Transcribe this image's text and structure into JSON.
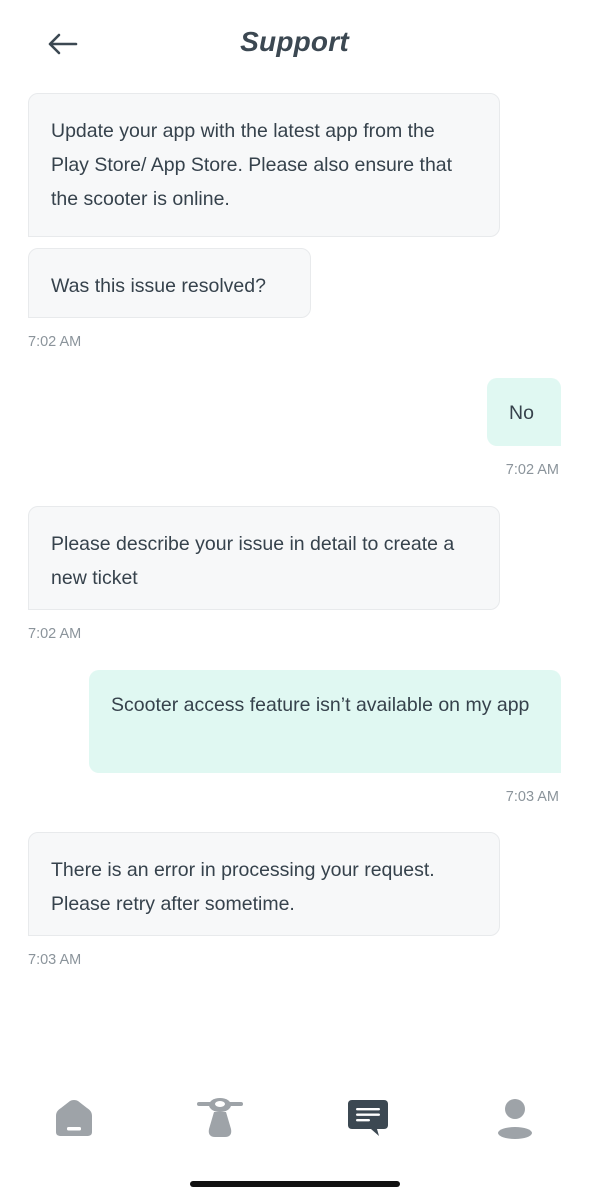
{
  "header": {
    "title": "Support",
    "back_icon": "arrow-left-icon"
  },
  "messages": [
    {
      "sender": "bot",
      "text": "Update your app with the latest app from the Play Store/ App Store. Please also ensure that the scooter is online."
    },
    {
      "sender": "bot",
      "text": "Was this issue resolved?",
      "time": "7:02 AM"
    },
    {
      "sender": "user",
      "text": "No",
      "time": "7:02 AM"
    },
    {
      "sender": "bot",
      "text": "Please describe your issue in detail to create a new ticket",
      "time": "7:02 AM"
    },
    {
      "sender": "user",
      "text": "Scooter access feature isn’t available on my app",
      "time": "7:03 AM"
    },
    {
      "sender": "bot",
      "text": "There is an error in processing your request. Please retry after sometime.",
      "time": "7:03 AM"
    }
  ],
  "tabs": [
    {
      "icon": "home-icon",
      "active": false
    },
    {
      "icon": "scooter-icon",
      "active": false
    },
    {
      "icon": "chat-icon",
      "active": true
    },
    {
      "icon": "profile-icon",
      "active": false
    }
  ],
  "colors": {
    "user_bubble": "#e0f8f2",
    "bot_bubble": "#f7f8f9",
    "tab_inactive": "#9ea3a8",
    "tab_active": "#3c4852"
  }
}
